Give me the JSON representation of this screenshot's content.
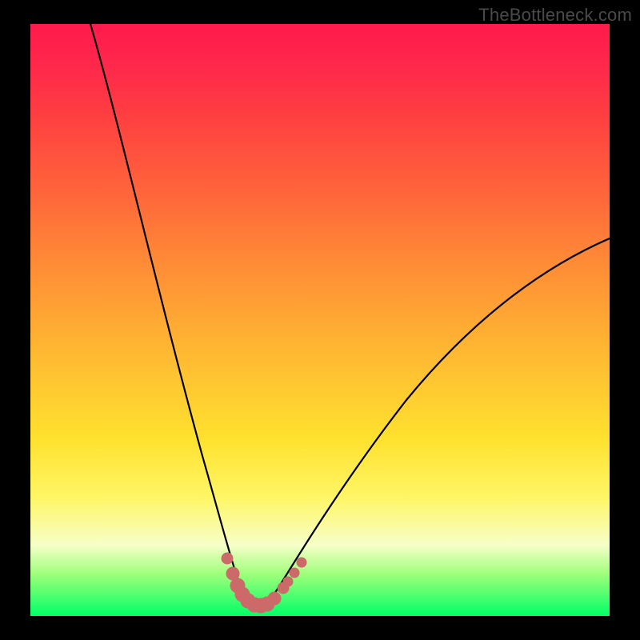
{
  "watermark": "TheBottleneck.com",
  "chart_data": {
    "type": "line",
    "title": "",
    "xlabel": "",
    "ylabel": "",
    "xlim": [
      0,
      100
    ],
    "ylim": [
      0,
      100
    ],
    "series": [
      {
        "name": "bottleneck-curve",
        "x": [
          0,
          4,
          8,
          12,
          16,
          20,
          24,
          27,
          30,
          32,
          34,
          36,
          38,
          40,
          44,
          50,
          58,
          68,
          80,
          92,
          100
        ],
        "y": [
          100,
          88,
          76,
          64,
          52,
          40,
          28,
          18,
          10,
          6,
          3,
          1,
          0.5,
          1,
          4,
          10,
          20,
          33,
          47,
          58,
          64
        ]
      }
    ],
    "markers": {
      "name": "highlight-dots",
      "color": "#cc6a6a",
      "x": [
        30.5,
        31.8,
        33.0,
        34.0,
        35.0,
        36.0,
        37.0,
        38.0,
        39.2,
        40.5,
        42.0,
        43.5,
        45.0
      ],
      "y": [
        9.5,
        7.2,
        5.2,
        3.8,
        2.6,
        1.8,
        1.3,
        1.3,
        1.8,
        2.6,
        4.0,
        5.6,
        7.6
      ]
    },
    "gradient_stops": [
      {
        "pos": 0.0,
        "color": "#ff1a4d"
      },
      {
        "pos": 0.3,
        "color": "#ff6a3a"
      },
      {
        "pos": 0.7,
        "color": "#ffe12e"
      },
      {
        "pos": 0.9,
        "color": "#d8ffb0"
      },
      {
        "pos": 1.0,
        "color": "#00ff66"
      }
    ]
  }
}
